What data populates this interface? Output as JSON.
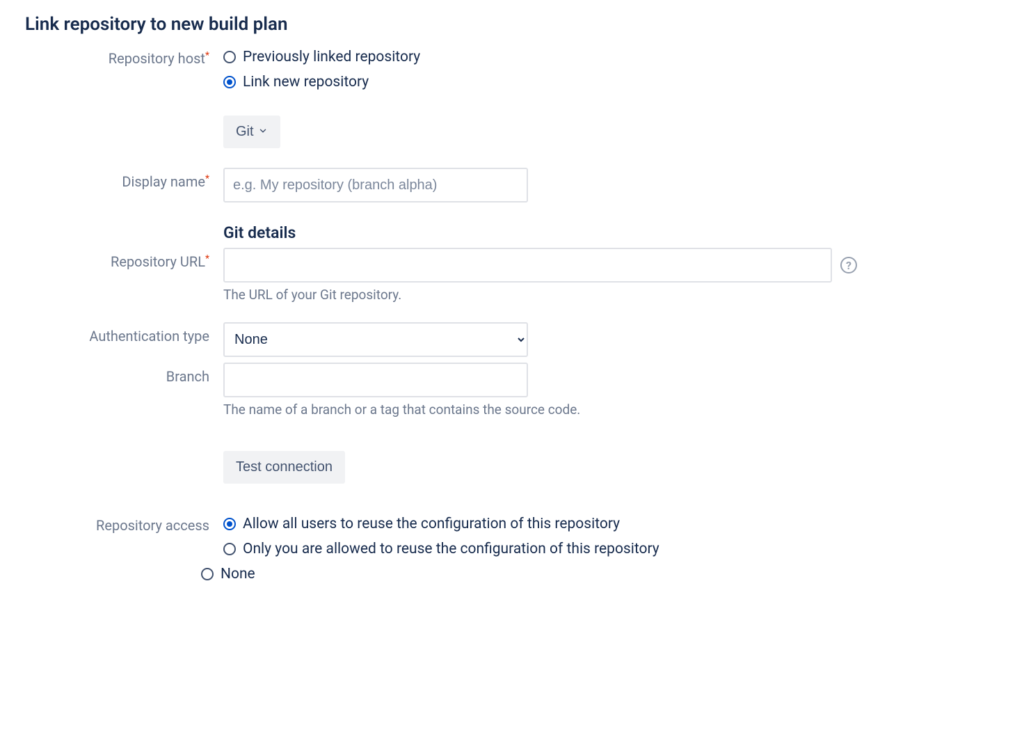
{
  "title": "Link repository to new build plan",
  "repo_host": {
    "label": "Repository host",
    "required": true,
    "options": {
      "previous": "Previously linked repository",
      "new": "Link new repository"
    },
    "selected": "new",
    "repo_type_button": "Git"
  },
  "display_name": {
    "label": "Display name",
    "required": true,
    "placeholder": "e.g. My repository (branch alpha)",
    "value": ""
  },
  "git_details": {
    "title": "Git details",
    "repo_url": {
      "label": "Repository URL",
      "required": true,
      "value": "",
      "helper": "The URL of your Git repository."
    },
    "auth_type": {
      "label": "Authentication type",
      "value": "None",
      "options": [
        "None"
      ]
    },
    "branch": {
      "label": "Branch",
      "value": "",
      "helper": "The name of a branch or a tag that contains the source code."
    },
    "test_button": "Test connection"
  },
  "repo_access": {
    "label": "Repository access",
    "options": {
      "all": "Allow all users to reuse the configuration of this repository",
      "you": "Only you are allowed to reuse the configuration of this repository",
      "none": "None"
    },
    "selected": "all"
  }
}
